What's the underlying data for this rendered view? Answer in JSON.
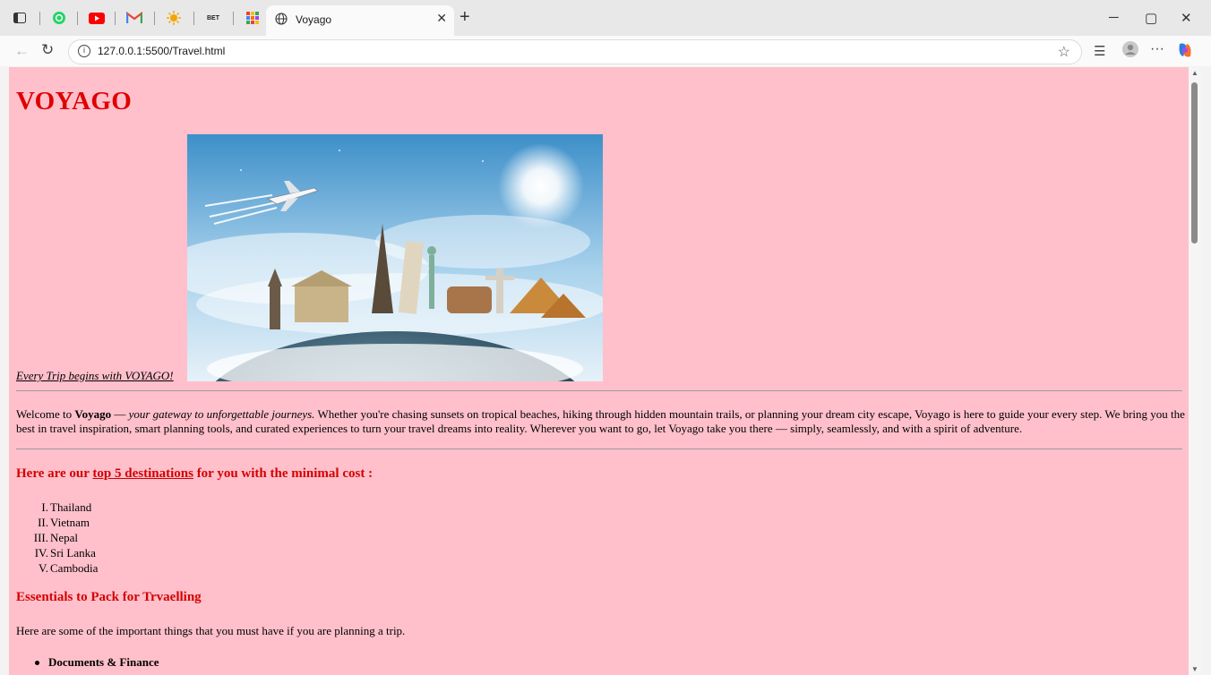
{
  "browser": {
    "tab_title": "Voyago",
    "url": "127.0.0.1:5500/Travel.html",
    "pinned_tabs": [
      "sidebar-icon",
      "whatsapp-icon",
      "youtube-icon",
      "gmail-icon",
      "sun-icon",
      "bet-icon",
      "apps-grid-icon"
    ],
    "pinned_bet_label": "BET"
  },
  "page": {
    "title": "VOYAGO",
    "tagline": "Every Trip begins with VOYAGO!",
    "intro": {
      "welcome": "Welcome to ",
      "brand": "Voyago",
      "dash": " — ",
      "tag": "your gateway to unforgettable journeys.",
      "rest": " Whether you're chasing sunsets on tropical beaches, hiking through hidden mountain trails, or planning your dream city escape, Voyago is here to guide your every step. We bring you the best in travel inspiration, smart planning tools, and curated experiences to turn your travel dreams into reality. Wherever you want to go, let Voyago take you there — simply, seamlessly, and with a spirit of adventure."
    },
    "dest_heading_pre": "Here are our ",
    "dest_heading_link": "top 5 destinations",
    "dest_heading_post": " for you with the minimal cost :",
    "destinations": [
      {
        "num": "I.",
        "name": "Thailand"
      },
      {
        "num": "II.",
        "name": "Vietnam"
      },
      {
        "num": "III.",
        "name": "Nepal"
      },
      {
        "num": "IV.",
        "name": "Sri Lanka"
      },
      {
        "num": "V.",
        "name": "Cambodia"
      }
    ],
    "pack_heading": "Essentials to Pack for Trvaelling",
    "pack_intro": "Here are some of the important things that you must have if you are planning a trip.",
    "pack_items": [
      "Documents & Finance"
    ]
  },
  "colors": {
    "page_bg": "#ffc0cb",
    "heading_red": "#e00000",
    "subheading_red": "#d40000"
  }
}
